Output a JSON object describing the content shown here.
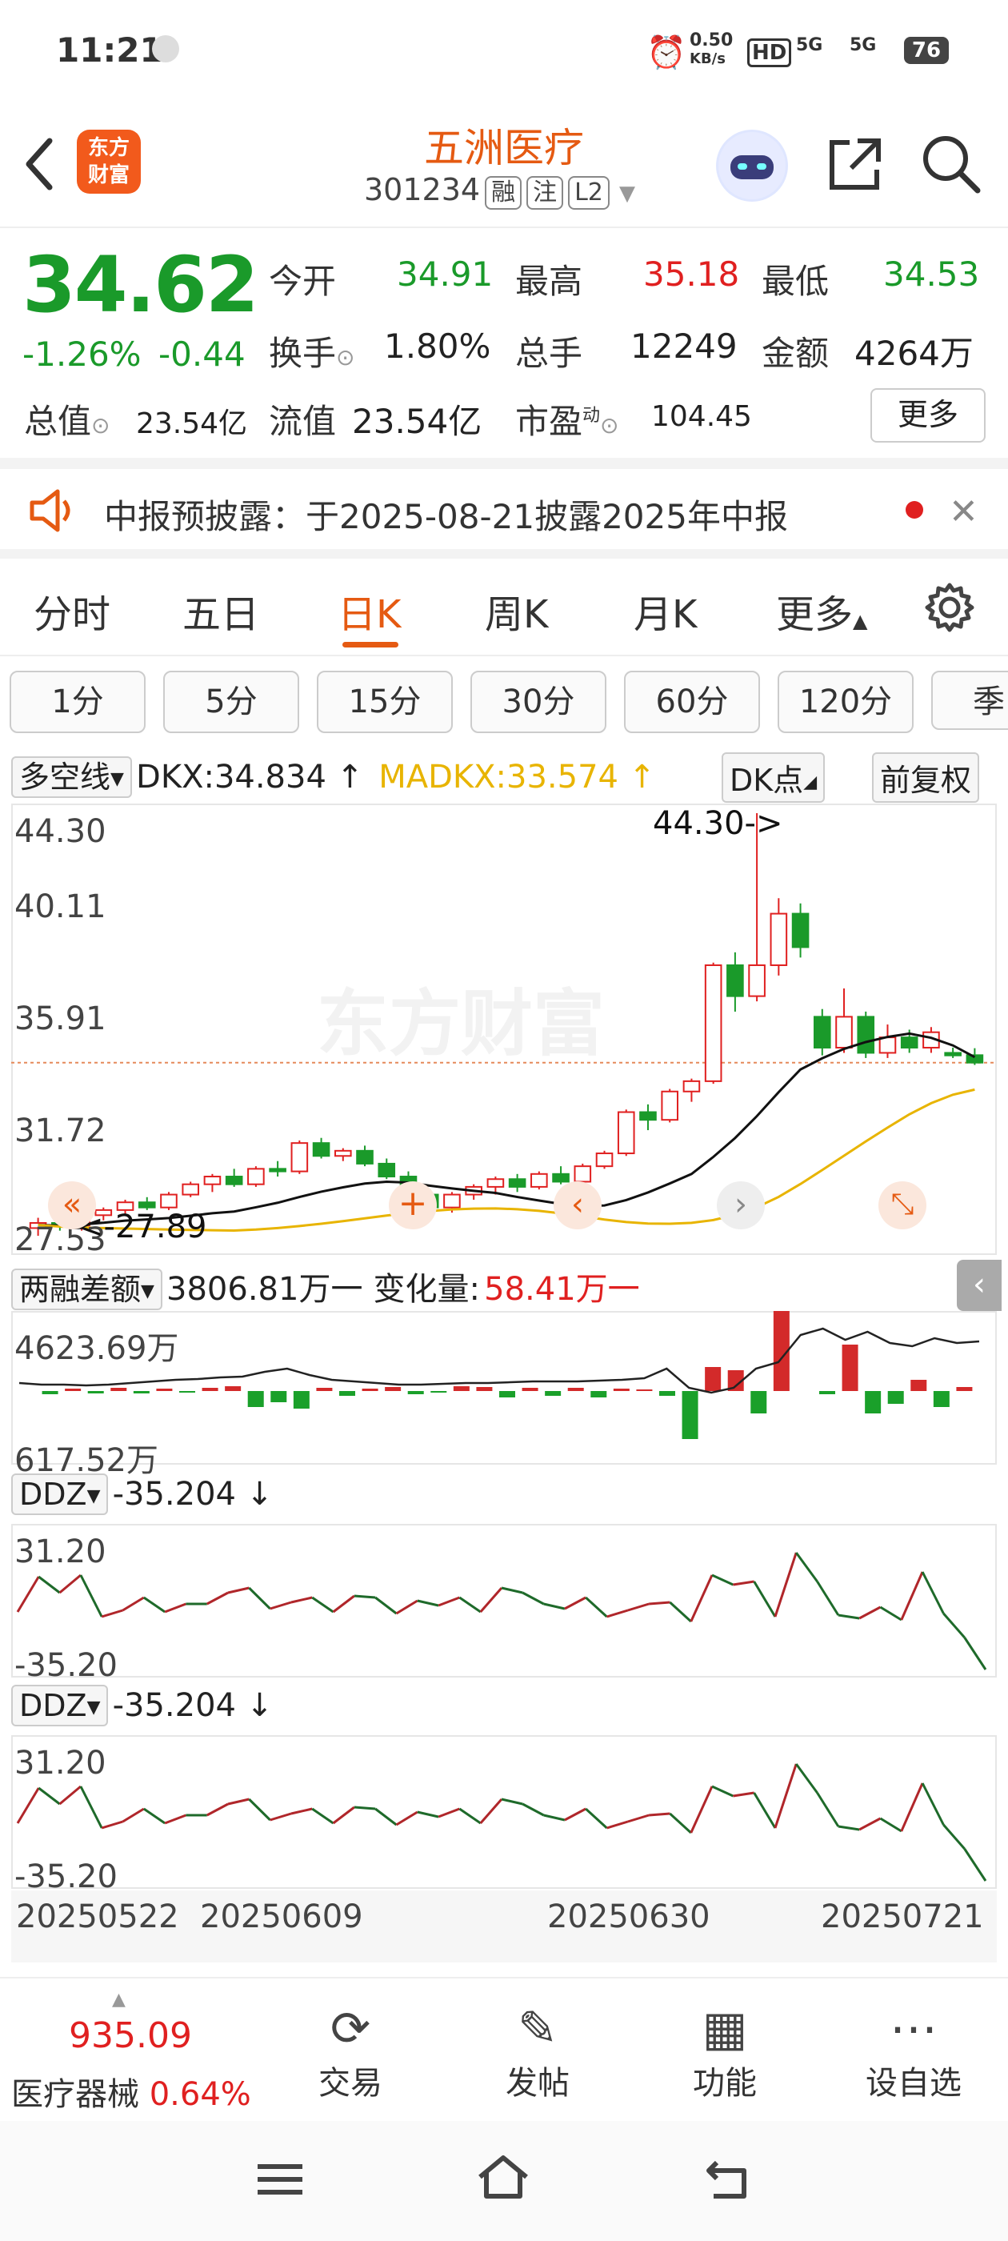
{
  "status_bar": {
    "time": "11:21",
    "net_speed": "0.50",
    "net_unit": "KB/s",
    "hd": "HD",
    "sig1": "5G",
    "sig2": "5G",
    "battery": "76"
  },
  "header": {
    "logo_line1": "东方",
    "logo_line2": "财富",
    "title": "五洲医疗",
    "code": "301234",
    "tag1": "融",
    "tag2": "注",
    "tag3": "L2"
  },
  "quote": {
    "price": "34.62",
    "change_pct": "-1.26%",
    "change_abs": "-0.44",
    "open_label": "今开",
    "open": "34.91",
    "high_label": "最高",
    "high": "35.18",
    "low_label": "最低",
    "low": "34.53",
    "turnover_label": "换手",
    "turnover": "1.80%",
    "volume_label": "总手",
    "volume": "12249",
    "amount_label": "金额",
    "amount": "4264万",
    "mktcap_label": "总值",
    "mktcap": "23.54亿",
    "float_label": "流值",
    "float": "23.54亿",
    "pe_label": "市盈",
    "pe_sup": "动",
    "pe": "104.45",
    "more": "更多"
  },
  "notice": {
    "text": "中报预披露：于2025-08-21披露2025年中报"
  },
  "tabs": [
    "分时",
    "五日",
    "日K",
    "周K",
    "月K",
    "更多"
  ],
  "periods": [
    "1分",
    "5分",
    "15分",
    "30分",
    "60分",
    "120分",
    "季"
  ],
  "indicator": {
    "name": "多空线",
    "dkx": "DKX:34.834 ↑",
    "madkx": "MADKX:33.574 ↑",
    "dk_btn": "DK点",
    "adj_btn": "前复权"
  },
  "kchart": {
    "y_top": "44.30",
    "y2": "40.11",
    "y3": "35.91",
    "y4": "31.72",
    "y_bottom": "27.53",
    "max_label": "44.30->",
    "min_label": "<-27.89",
    "watermark": "东方财富"
  },
  "margin": {
    "title": "两融差额",
    "value": "3806.81万一",
    "change_label": "变化量:",
    "change": "58.41万一",
    "y_top": "4623.69万",
    "y_bottom": "617.52万"
  },
  "ddz1": {
    "title": "DDZ",
    "value": "-35.204 ↓",
    "y_top": "31.20",
    "y_bottom": "-35.20"
  },
  "ddz2": {
    "title": "DDZ",
    "value": "-35.204 ↓",
    "y_top": "31.20",
    "y_bottom": "-35.20"
  },
  "x_ticks": [
    "20250522",
    "20250609",
    "20250630",
    "20250721"
  ],
  "chart_data": {
    "type": "candlestick",
    "y_range": [
      27.53,
      44.3
    ],
    "candles": [
      [
        28.2,
        28.6,
        27.9,
        28.4
      ],
      [
        28.4,
        28.7,
        28.1,
        28.3
      ],
      [
        28.3,
        28.8,
        28.1,
        28.7
      ],
      [
        28.7,
        29.0,
        28.5,
        28.9
      ],
      [
        28.9,
        29.3,
        28.7,
        29.2
      ],
      [
        29.2,
        29.4,
        28.9,
        29.0
      ],
      [
        29.0,
        29.6,
        28.9,
        29.5
      ],
      [
        29.5,
        30.0,
        29.4,
        29.9
      ],
      [
        29.9,
        30.3,
        29.6,
        30.2
      ],
      [
        30.2,
        30.5,
        29.8,
        29.9
      ],
      [
        29.9,
        30.6,
        29.8,
        30.5
      ],
      [
        30.5,
        30.8,
        30.2,
        30.4
      ],
      [
        30.4,
        31.6,
        30.3,
        31.5
      ],
      [
        31.5,
        31.7,
        30.9,
        31.0
      ],
      [
        31.0,
        31.3,
        30.8,
        31.2
      ],
      [
        31.2,
        31.4,
        30.6,
        30.7
      ],
      [
        30.7,
        30.9,
        30.1,
        30.2
      ],
      [
        30.2,
        30.4,
        29.4,
        29.5
      ],
      [
        29.5,
        29.7,
        28.9,
        29.0
      ],
      [
        29.0,
        29.6,
        28.8,
        29.5
      ],
      [
        29.5,
        29.9,
        29.3,
        29.8
      ],
      [
        29.8,
        30.2,
        29.5,
        30.1
      ],
      [
        30.1,
        30.3,
        29.6,
        29.8
      ],
      [
        29.8,
        30.4,
        29.7,
        30.3
      ],
      [
        30.3,
        30.6,
        29.9,
        30.0
      ],
      [
        30.0,
        30.7,
        29.9,
        30.6
      ],
      [
        30.6,
        31.2,
        30.5,
        31.1
      ],
      [
        31.1,
        32.8,
        31.0,
        32.7
      ],
      [
        32.7,
        33.0,
        32.0,
        32.4
      ],
      [
        32.4,
        33.6,
        32.3,
        33.5
      ],
      [
        33.5,
        34.0,
        33.1,
        33.9
      ],
      [
        33.9,
        38.5,
        33.8,
        38.4
      ],
      [
        38.4,
        38.9,
        36.6,
        37.2
      ],
      [
        37.2,
        44.3,
        37.0,
        38.4
      ],
      [
        38.4,
        41.0,
        38.0,
        40.4
      ],
      [
        40.4,
        40.8,
        38.7,
        39.1
      ],
      [
        36.4,
        36.7,
        34.9,
        35.2
      ],
      [
        35.2,
        37.5,
        35.0,
        36.4
      ],
      [
        36.4,
        36.6,
        34.8,
        35.0
      ],
      [
        35.0,
        36.1,
        34.8,
        35.6
      ],
      [
        35.6,
        35.9,
        35.0,
        35.2
      ],
      [
        35.2,
        36.0,
        35.0,
        35.8
      ],
      [
        35.0,
        35.2,
        34.8,
        34.9
      ],
      [
        34.91,
        35.18,
        34.53,
        34.62
      ]
    ],
    "dkx_last": 34.834,
    "madkx_last": 33.574,
    "margin_balance_last": "3806.81万",
    "ddz_last": -35.204
  },
  "bottom": {
    "index_value": "935.09",
    "sector": "医疗器械",
    "sector_pct": "0.64%",
    "nav": [
      "交易",
      "发帖",
      "功能",
      "设自选"
    ]
  }
}
